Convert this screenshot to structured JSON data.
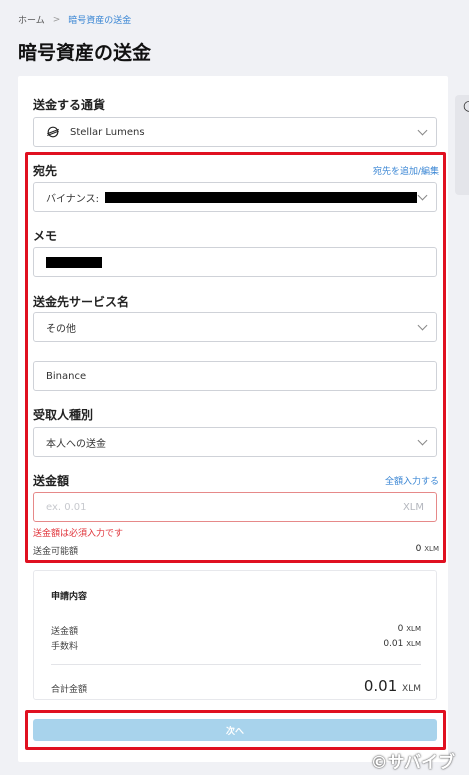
{
  "breadcrumb": {
    "home": "ホーム",
    "separator": ">",
    "current": "暗号資産の送金"
  },
  "page": {
    "title": "暗号資産の送金"
  },
  "form": {
    "currency": {
      "label": "送金する通貨",
      "value": "Stellar Lumens",
      "icon": "stellar-icon"
    },
    "destination": {
      "label": "宛先",
      "link": "宛先を追加/編集",
      "value_prefix": "バイナンス:"
    },
    "memo": {
      "label": "メモ"
    },
    "service": {
      "label": "送金先サービス名",
      "value": "その他",
      "other_value": "Binance"
    },
    "recipient_type": {
      "label": "受取人種別",
      "value": "本人への送金"
    },
    "amount": {
      "label": "送金額",
      "link": "全額入力する",
      "placeholder": "ex. 0.01",
      "unit": "XLM",
      "error": "送金額は必須入力です",
      "available_label": "送金可能額",
      "available_value": "0",
      "available_unit": "XLM"
    }
  },
  "summary": {
    "title": "申請内容",
    "amount_label": "送金額",
    "amount_value": "0",
    "amount_unit": "XLM",
    "fee_label": "手数料",
    "fee_value": "0.01",
    "fee_unit": "XLM",
    "total_label": "合計金額",
    "total_value": "0.01",
    "total_unit": "XLM"
  },
  "actions": {
    "next": "次へ"
  },
  "watermark": "©サバイブ",
  "colors": {
    "accent": "#3a86d4",
    "error": "#e0333a",
    "highlight": "#e01020",
    "button_disabled": "#a8d3ec"
  }
}
